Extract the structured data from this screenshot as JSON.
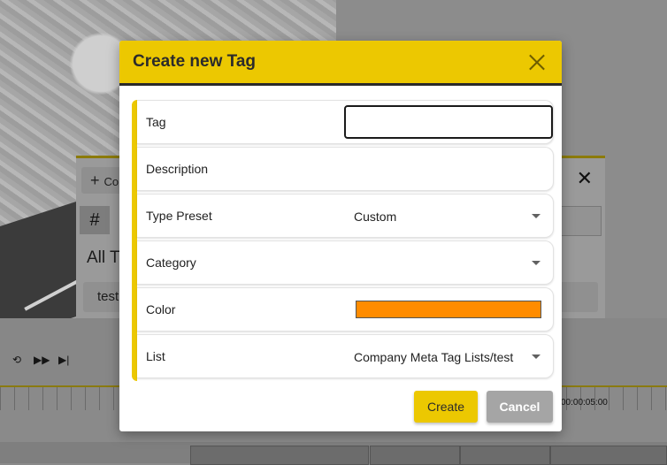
{
  "background": {
    "panel_add_label": "Co",
    "panel_hash": "#",
    "panel_heading": "All T",
    "panel_row": "test",
    "timecode": "00:00:05:00"
  },
  "modal": {
    "title": "Create new Tag",
    "fields": {
      "tag": {
        "label": "Tag",
        "value": ""
      },
      "description": {
        "label": "Description"
      },
      "type_preset": {
        "label": "Type Preset",
        "value": "Custom"
      },
      "category": {
        "label": "Category",
        "value": ""
      },
      "color": {
        "label": "Color",
        "value": "#ff8c00"
      },
      "list": {
        "label": "List",
        "value": "Company Meta Tag Lists/test"
      }
    },
    "buttons": {
      "create": "Create",
      "cancel": "Cancel"
    }
  },
  "colors": {
    "accent": "#ecc801",
    "cancel": "#a5a5a5"
  }
}
